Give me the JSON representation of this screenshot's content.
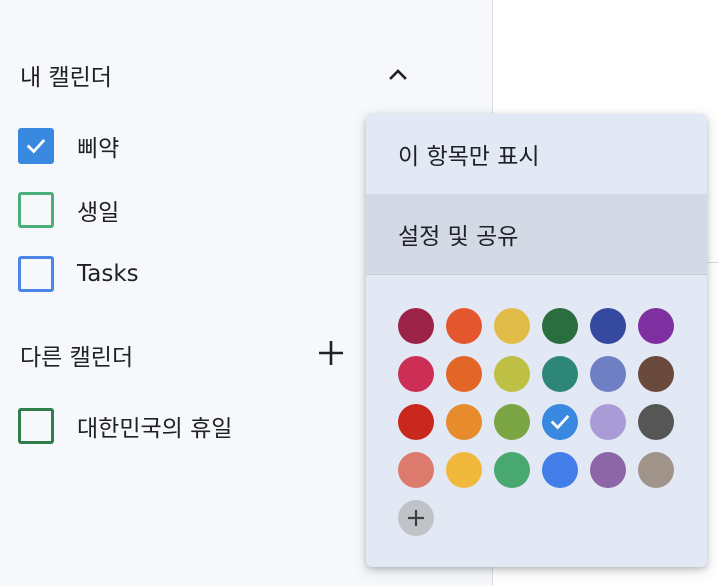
{
  "sidebar": {
    "my_calendars": {
      "title": "내 캘린더",
      "items": [
        {
          "label": "삐약",
          "checked": true,
          "color": "#3a89e0"
        },
        {
          "label": "생일",
          "checked": false,
          "color": "#4caf7a"
        },
        {
          "label": "Tasks",
          "checked": false,
          "color": "#4a86e8"
        }
      ]
    },
    "other_calendars": {
      "title": "다른 캘린더",
      "items": [
        {
          "label": "대한민국의 휴일",
          "checked": false,
          "color": "#2e7d4a"
        }
      ]
    }
  },
  "menu": {
    "items": [
      {
        "label": "이 항목만 표시"
      },
      {
        "label": "설정 및 공유"
      }
    ],
    "selected_color": "#3a89e0",
    "palette": [
      [
        "#9c2348",
        "#e4572e",
        "#e1bc49",
        "#2a6e40",
        "#354a9e",
        "#7e30a0"
      ],
      [
        "#cc2e56",
        "#e26628",
        "#bec045",
        "#2e8678",
        "#6e7fc4",
        "#6b4a3e"
      ],
      [
        "#c8281e",
        "#e68c2c",
        "#7ca643",
        "#3a89e0",
        "#a89bd6",
        "#565656"
      ],
      [
        "#dc7a6e",
        "#f0b83c",
        "#48a870",
        "#437de8",
        "#8c66a6",
        "#a0948a"
      ]
    ]
  }
}
